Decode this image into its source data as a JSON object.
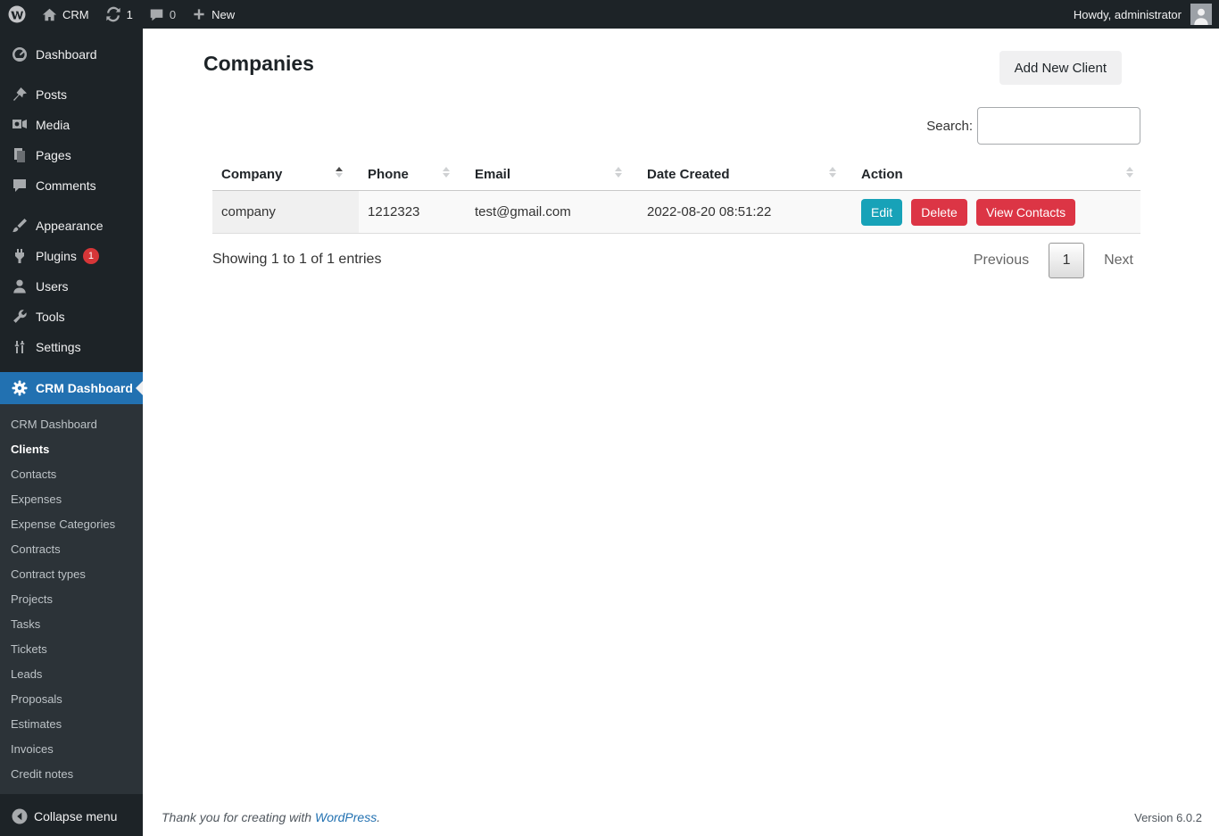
{
  "admin_bar": {
    "site_name": "CRM",
    "update_count": "1",
    "comment_count": "0",
    "new_label": "New",
    "howdy": "Howdy, administrator"
  },
  "sidebar": {
    "items": [
      {
        "label": "Dashboard"
      },
      {
        "label": "Posts"
      },
      {
        "label": "Media"
      },
      {
        "label": "Pages"
      },
      {
        "label": "Comments"
      },
      {
        "label": "Appearance"
      },
      {
        "label": "Plugins",
        "badge": "1"
      },
      {
        "label": "Users"
      },
      {
        "label": "Tools"
      },
      {
        "label": "Settings"
      },
      {
        "label": "CRM Dashboard"
      }
    ],
    "submenu": [
      "CRM Dashboard",
      "Clients",
      "Contacts",
      "Expenses",
      "Expense Categories",
      "Contracts",
      "Contract types",
      "Projects",
      "Tasks",
      "Tickets",
      "Leads",
      "Proposals",
      "Estimates",
      "Invoices",
      "Credit notes"
    ],
    "active_item": "CRM Dashboard",
    "active_submenu": "Clients",
    "collapse_label": "Collapse menu"
  },
  "main": {
    "title": "Companies",
    "add_button": "Add New Client",
    "search_label": "Search:",
    "table": {
      "columns": [
        "Company",
        "Phone",
        "Email",
        "Date Created",
        "Action"
      ],
      "rows": [
        {
          "company": "company",
          "phone": "1212323",
          "email": "test@gmail.com",
          "date_created": "2022-08-20 08:51:22"
        }
      ],
      "action_buttons": [
        "Edit",
        "Delete",
        "View Contacts"
      ]
    },
    "info": "Showing 1 to 1 of 1 entries",
    "pagination": {
      "previous": "Previous",
      "current": "1",
      "next": "Next"
    }
  },
  "footer": {
    "thanks_prefix": "Thank you for creating with ",
    "link_text": "WordPress",
    "suffix": ".",
    "version": "Version 6.0.2"
  },
  "colors": {
    "accent_blue": "#2271b1",
    "menu_bg": "#1d2327",
    "submenu_bg": "#2c3338",
    "badge_red": "#d63638",
    "edit_teal": "#17a2b8",
    "danger_red": "#dc3545"
  }
}
